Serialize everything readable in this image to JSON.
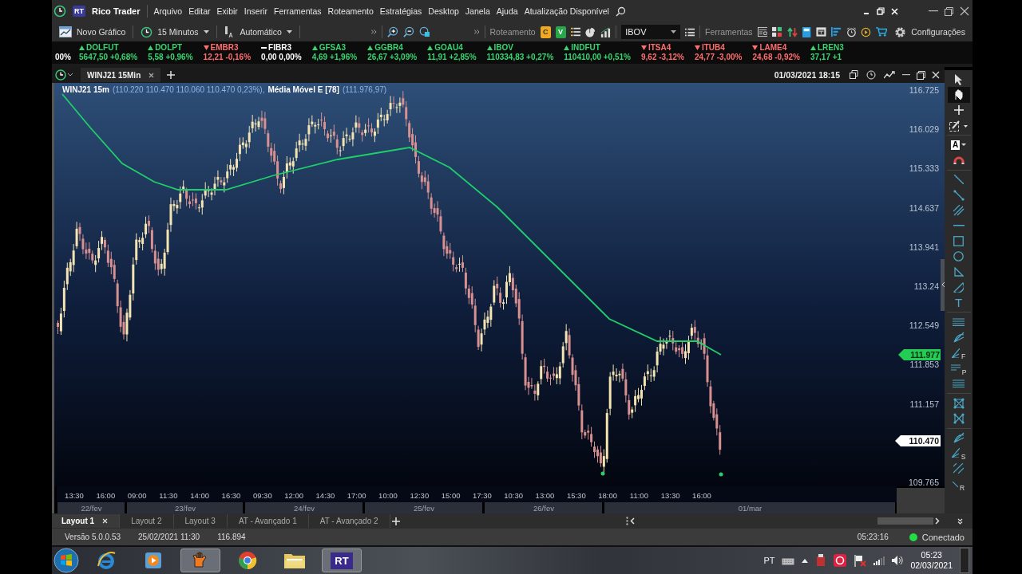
{
  "app": {
    "logo": "RT",
    "name": "Rico Trader"
  },
  "menu": [
    "Arquivo",
    "Editar",
    "Exibir",
    "Inserir",
    "Ferramentas",
    "Roteamento",
    "Estratégias",
    "Desktop",
    "Janela",
    "Ajuda"
  ],
  "update_notice": "Atualização Disponível",
  "toolbar": {
    "new_chart": "Novo Gráfico",
    "interval": "15 Minutos",
    "scale": "Automático",
    "routing_label": "Roteamento",
    "buy_key": "C",
    "sell_key": "V",
    "symbol": "IBOV",
    "tools_label": "Ferramentas",
    "settings": "Configurações"
  },
  "ticker": [
    {
      "quote": "00%",
      "kind": "flat"
    },
    {
      "symbol": "DOLFUT",
      "quote": "5647,50 +0,68%",
      "kind": "up"
    },
    {
      "symbol": "DOLPT",
      "quote": "5,58 +0,96%",
      "kind": "up"
    },
    {
      "symbol": "EMBR3",
      "quote": "12,21 -0,16%",
      "kind": "down"
    },
    {
      "symbol": "FIBR3",
      "quote": "0,00 0,00%",
      "kind": "flat"
    },
    {
      "symbol": "GFSA3",
      "quote": "4,69 +1,96%",
      "kind": "up"
    },
    {
      "symbol": "GGBR4",
      "quote": "26,67 +3,09%",
      "kind": "up"
    },
    {
      "symbol": "GOAU4",
      "quote": "11,91 +2,85%",
      "kind": "up"
    },
    {
      "symbol": "IBOV",
      "quote": "110334,83 +0,27%",
      "kind": "up"
    },
    {
      "symbol": "INDFUT",
      "quote": "110410,00 +0,51%",
      "kind": "up"
    },
    {
      "symbol": "ITSA4",
      "quote": "9,62 -3,12%",
      "kind": "down"
    },
    {
      "symbol": "ITUB4",
      "quote": "24,77 -3,00%",
      "kind": "down"
    },
    {
      "symbol": "LAME4",
      "quote": "24,68 -0,92%",
      "kind": "down"
    },
    {
      "symbol": "LREN3",
      "quote": "37,17 +1",
      "kind": "up"
    }
  ],
  "chart_window": {
    "tabs": [
      {
        "label": "WINJ21 15Min",
        "selected": true
      }
    ],
    "datetime": "01/03/2021 18:15",
    "legend": {
      "symbol": "WINJ21 15m",
      "values": "(110.220  110.470  110.060  110.470  0,23%),",
      "indicator": "Média Móvel E [78]",
      "indicator_value": "(111.976,97)"
    },
    "price_labels": [
      "116.725",
      "116.029",
      "115.333",
      "114.637",
      "113.941",
      "113.24",
      "112.549",
      "111.853",
      "111.157",
      "109.765"
    ],
    "ma_price": "111.977",
    "last_price": "110.470",
    "time_labels": [
      "13:30",
      "16:00",
      "09:00",
      "11:30",
      "14:00",
      "16:30",
      "09:30",
      "12:00",
      "14:30",
      "17:00",
      "10:00",
      "12:30",
      "15:00",
      "17:30",
      "10:30",
      "13:00",
      "15:30",
      "18:00",
      "11:00",
      "13:30",
      "16:00"
    ],
    "date_labels": [
      "22/fev",
      "23/fev",
      "24/fev",
      "25/fev",
      "26/fev",
      "01/mar"
    ]
  },
  "tools": [
    {
      "kind": "pointer",
      "selected": false
    },
    {
      "kind": "hand",
      "selected": true
    },
    {
      "kind": "cross",
      "selected": false
    },
    {
      "kind": "edit",
      "selected": false
    },
    {
      "kind": "label",
      "label": "A",
      "selected": false
    },
    {
      "kind": "magnet",
      "selected": false
    },
    {
      "kind": "line",
      "selected": false
    },
    {
      "kind": "segment",
      "selected": false
    },
    {
      "kind": "parallel",
      "selected": false
    },
    {
      "kind": "hline",
      "selected": false
    },
    {
      "kind": "rect",
      "selected": false
    },
    {
      "kind": "circle",
      "selected": false
    },
    {
      "kind": "triangle",
      "selected": false
    },
    {
      "kind": "arc",
      "selected": false
    },
    {
      "kind": "text",
      "label": "T",
      "selected": false
    },
    {
      "kind": "lines",
      "selected": false
    },
    {
      "kind": "fan",
      "selected": false
    },
    {
      "kind": "fanletter",
      "label": "F",
      "selected": false
    },
    {
      "kind": "linesletter",
      "label": "P",
      "selected": false
    },
    {
      "kind": "lines",
      "selected": false
    },
    {
      "kind": "net",
      "selected": false
    },
    {
      "kind": "netx",
      "selected": false
    },
    {
      "kind": "fan",
      "selected": false
    },
    {
      "kind": "fanletter",
      "label": "S",
      "selected": false
    },
    {
      "kind": "diag",
      "selected": false
    },
    {
      "kind": "diagletter",
      "label": "R",
      "selected": false
    }
  ],
  "layout_tabs": [
    {
      "label": "Layout 1",
      "selected": true
    },
    {
      "label": "Layout 2",
      "selected": false
    },
    {
      "label": "Layout 3",
      "selected": false
    },
    {
      "label": "AT - Avançado 1",
      "selected": false
    },
    {
      "label": "AT - Avançado 2",
      "selected": false
    }
  ],
  "status_bar": {
    "version": "Versão 5.0.0.53",
    "date": "25/02/2021 11:30",
    "value": "116.894",
    "clock": "05:23:16",
    "connection": "Conectado",
    "connected": true
  },
  "taskbar": {
    "apps": [
      {
        "kind": "ie",
        "selected": false
      },
      {
        "kind": "media",
        "selected": false
      },
      {
        "kind": "glove",
        "selected": true
      },
      {
        "kind": "browser",
        "selected": false
      },
      {
        "kind": "folder",
        "selected": false
      },
      {
        "kind": "rt",
        "label": "RT",
        "selected": true
      }
    ],
    "language": "PT",
    "time": "05:23",
    "date": "02/03/2021"
  }
}
